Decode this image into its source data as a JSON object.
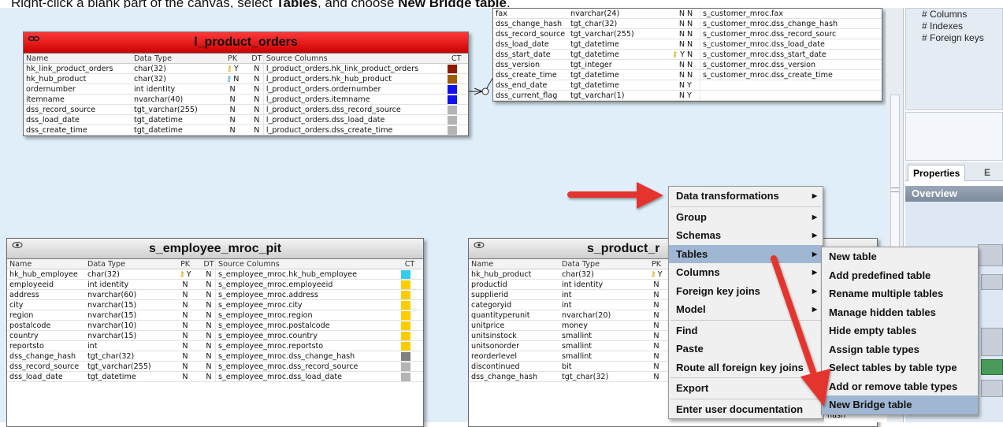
{
  "instruction": {
    "prefix": "Right-click a blank part of the canvas, select ",
    "bold1": "Tables",
    "middle": ", and choose ",
    "bold2": "New Bridge table",
    "suffix": "."
  },
  "colors": {
    "canvas": "#dfeef8",
    "menu_highlight": "#c6d6e8",
    "menu_selected": "#9fb7d3",
    "arrow": "#e3342f",
    "link_header": "#ee1111"
  },
  "col_headers": {
    "name": "Name",
    "type": "Data Type",
    "pk": "PK",
    "dt": "DT",
    "src": "Source Columns",
    "ct": "CT"
  },
  "top_table": {
    "rows": [
      {
        "name": "fax",
        "type": "nvarchar(24)",
        "pk": "N",
        "dt": "N",
        "src": "s_customer_mroc.fax",
        "key": ""
      },
      {
        "name": "dss_change_hash",
        "type": "tgt_char(32)",
        "pk": "N",
        "dt": "N",
        "src": "s_customer_mroc.dss_change_hash",
        "key": ""
      },
      {
        "name": "dss_record_source",
        "type": "tgt_varchar(255)",
        "pk": "N",
        "dt": "N",
        "src": "s_customer_mroc.dss_record_sourc",
        "key": ""
      },
      {
        "name": "dss_load_date",
        "type": "tgt_datetime",
        "pk": "N",
        "dt": "N",
        "src": "s_customer_mroc.dss_load_date",
        "key": ""
      },
      {
        "name": "dss_start_date",
        "type": "tgt_datetime",
        "pk": "Y",
        "dt": "N",
        "src": "s_customer_mroc.dss_start_date",
        "key": "gold"
      },
      {
        "name": "dss_version",
        "type": "tgt_integer",
        "pk": "N",
        "dt": "N",
        "src": "s_customer_mroc.dss_version",
        "key": ""
      },
      {
        "name": "dss_create_time",
        "type": "tgt_datetime",
        "pk": "N",
        "dt": "N",
        "src": "s_customer_mroc.dss_create_time",
        "key": ""
      },
      {
        "name": "dss_end_date",
        "type": "tgt_datetime",
        "pk": "N",
        "dt": "Y",
        "src": "",
        "key": ""
      },
      {
        "name": "dss_current_flag",
        "type": "tgt_varchar(1)",
        "pk": "N",
        "dt": "Y",
        "src": "",
        "key": ""
      }
    ]
  },
  "l_product_orders": {
    "title": "l_product_orders",
    "icon": "link-icon",
    "rows": [
      {
        "name": "hk_link_product_orders",
        "type": "char(32)",
        "pk": "Y",
        "dt": "N",
        "src": "l_product_orders.hk_link_product_orders",
        "key": "gold",
        "ct": "#8b1a00"
      },
      {
        "name": "hk_hub_product",
        "type": "char(32)",
        "pk": "N",
        "dt": "N",
        "src": "l_product_orders.hk_hub_product",
        "key": "blue",
        "ct": "#a05a00"
      },
      {
        "name": "ordernumber",
        "type": "int identity",
        "pk": "N",
        "dt": "N",
        "src": "l_product_orders.ordernumber",
        "key": "",
        "ct": "#1010ee"
      },
      {
        "name": "itemname",
        "type": "nvarchar(40)",
        "pk": "N",
        "dt": "N",
        "src": "l_product_orders.itemname",
        "key": "",
        "ct": "#1010ee"
      },
      {
        "name": "dss_record_source",
        "type": "tgt_varchar(255)",
        "pk": "N",
        "dt": "N",
        "src": "l_product_orders.dss_record_source",
        "key": "",
        "ct": "#b4b4b4"
      },
      {
        "name": "dss_load_date",
        "type": "tgt_datetime",
        "pk": "N",
        "dt": "N",
        "src": "l_product_orders.dss_load_date",
        "key": "",
        "ct": "#b4b4b4"
      },
      {
        "name": "dss_create_time",
        "type": "tgt_datetime",
        "pk": "N",
        "dt": "N",
        "src": "l_product_orders.dss_create_time",
        "key": "",
        "ct": "#b4b4b4"
      }
    ]
  },
  "s_employee_mroc_pit": {
    "title": "s_employee_mroc_pit",
    "icon": "eye-icon",
    "rows": [
      {
        "name": "hk_hub_employee",
        "type": "char(32)",
        "pk": "Y",
        "dt": "N",
        "src": "s_employee_mroc.hk_hub_employee",
        "key": "gold",
        "ct": "#33ccee"
      },
      {
        "name": "employeeid",
        "type": "int identity",
        "pk": "N",
        "dt": "N",
        "src": "s_employee_mroc.employeeid",
        "key": "",
        "ct": "#ffcc00"
      },
      {
        "name": "address",
        "type": "nvarchar(60)",
        "pk": "N",
        "dt": "N",
        "src": "s_employee_mroc.address",
        "key": "",
        "ct": "#ffcc00"
      },
      {
        "name": "city",
        "type": "nvarchar(15)",
        "pk": "N",
        "dt": "N",
        "src": "s_employee_mroc.city",
        "key": "",
        "ct": "#ffcc00"
      },
      {
        "name": "region",
        "type": "nvarchar(15)",
        "pk": "N",
        "dt": "N",
        "src": "s_employee_mroc.region",
        "key": "",
        "ct": "#ffcc00"
      },
      {
        "name": "postalcode",
        "type": "nvarchar(10)",
        "pk": "N",
        "dt": "N",
        "src": "s_employee_mroc.postalcode",
        "key": "",
        "ct": "#ffcc00"
      },
      {
        "name": "country",
        "type": "nvarchar(15)",
        "pk": "N",
        "dt": "N",
        "src": "s_employee_mroc.country",
        "key": "",
        "ct": "#ffcc00"
      },
      {
        "name": "reportsto",
        "type": "int",
        "pk": "N",
        "dt": "N",
        "src": "s_employee_mroc.reportsto",
        "key": "",
        "ct": "#ffcc00"
      },
      {
        "name": "dss_change_hash",
        "type": "tgt_char(32)",
        "pk": "N",
        "dt": "N",
        "src": "s_employee_mroc.dss_change_hash",
        "key": "",
        "ct": "#808080"
      },
      {
        "name": "dss_record_source",
        "type": "tgt_varchar(255)",
        "pk": "N",
        "dt": "N",
        "src": "s_employee_mroc.dss_record_source",
        "key": "",
        "ct": "#b4b4b4"
      },
      {
        "name": "dss_load_date",
        "type": "tgt_datetime",
        "pk": "N",
        "dt": "N",
        "src": "s_employee_mroc.dss_load_date",
        "key": "",
        "ct": "#b4b4b4"
      }
    ]
  },
  "s_product": {
    "title": "s_product_r",
    "icon": "eye-icon",
    "rows": [
      {
        "name": "hk_hub_product",
        "type": "char(32)",
        "pk": "Y",
        "key": "gold"
      },
      {
        "name": "productid",
        "type": "int identity",
        "pk": "N",
        "key": ""
      },
      {
        "name": "supplierid",
        "type": "int",
        "pk": "N",
        "key": ""
      },
      {
        "name": "categoryid",
        "type": "int",
        "pk": "N",
        "key": ""
      },
      {
        "name": "quantityperunit",
        "type": "nvarchar(20)",
        "pk": "N",
        "key": ""
      },
      {
        "name": "unitprice",
        "type": "money",
        "pk": "N",
        "key": ""
      },
      {
        "name": "unitsinstock",
        "type": "smallint",
        "pk": "N",
        "key": ""
      },
      {
        "name": "unitsonorder",
        "type": "smallint",
        "pk": "N",
        "key": ""
      },
      {
        "name": "reorderlevel",
        "type": "smallint",
        "pk": "N",
        "key": ""
      },
      {
        "name": "discontinued",
        "type": "bit",
        "pk": "N",
        "key": ""
      },
      {
        "name": "dss_change_hash",
        "type": "tgt_char(32)",
        "pk": "N",
        "key": ""
      }
    ]
  },
  "context_menu": [
    {
      "label": "Data transformations",
      "arrow": true,
      "sep_after": true
    },
    {
      "label": "Group",
      "arrow": true
    },
    {
      "label": "Schemas",
      "arrow": true
    },
    {
      "label": "Tables",
      "arrow": true,
      "selected": true
    },
    {
      "label": "Columns",
      "arrow": true
    },
    {
      "label": "Foreign key joins",
      "arrow": true
    },
    {
      "label": "Model",
      "arrow": true,
      "sep_after": true
    },
    {
      "label": "Find",
      "arrow": false
    },
    {
      "label": "Paste",
      "arrow": false
    },
    {
      "label": "Route all foreign key joins",
      "arrow": false,
      "sep_after": true
    },
    {
      "label": "Export",
      "arrow": true,
      "sep_after": true
    },
    {
      "label": "Enter user documentation",
      "arrow": false
    }
  ],
  "tables_submenu": [
    {
      "label": "New table"
    },
    {
      "label": "Add predefined table"
    },
    {
      "label": "Rename multiple tables"
    },
    {
      "label": "Manage hidden tables"
    },
    {
      "label": "Hide empty tables"
    },
    {
      "label": "Assign table types"
    },
    {
      "label": "Select tables by table type"
    },
    {
      "label": "Add or remove table types"
    },
    {
      "label": "New Bridge table",
      "highlight": true
    }
  ],
  "right_pane": {
    "tree": [
      "# Columns",
      "# Indexes",
      "# Foreign keys"
    ],
    "tab_properties": "Properties",
    "tab_other": "E",
    "overview": "Overview"
  },
  "partial_cell": "hash"
}
